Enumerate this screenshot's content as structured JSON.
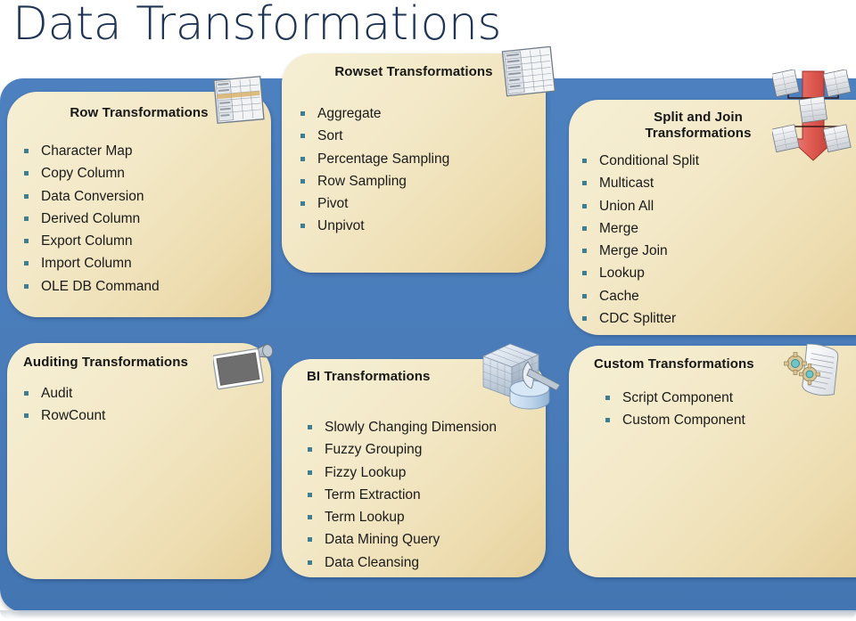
{
  "slide": {
    "title": "Data Transformations",
    "title_color": "#1F3556",
    "board_color": "#4A7CBA",
    "panel_color": "#F3E9C8",
    "bullet_color": "#3E7E92"
  },
  "panels": [
    {
      "id": "row",
      "title": "Row Transformations",
      "icon": "spreadsheet-grid-icon",
      "items": [
        "Character Map",
        "Copy Column",
        "Data Conversion",
        "Derived Column",
        "Export Column",
        "Import Column",
        "OLE DB Command"
      ]
    },
    {
      "id": "rowset",
      "title": "Rowset Transformations",
      "icon": "spreadsheet-grid-icon",
      "items": [
        "Aggregate",
        "Sort",
        "Percentage Sampling",
        "Row Sampling",
        "Pivot",
        "Unpivot"
      ]
    },
    {
      "id": "splitjoin",
      "title": "Split and Join Transformations",
      "title_line1": "Split and Join",
      "title_line2": "Transformations",
      "icon": "split-arrow-icon",
      "items": [
        "Conditional Split",
        "Multicast",
        "Union All",
        "Merge",
        "Merge Join",
        "Lookup",
        "Cache",
        "CDC Splitter"
      ]
    },
    {
      "id": "audit",
      "title": "Auditing Transformations",
      "icon": "monitor-icon",
      "items": [
        "Audit",
        "RowCount"
      ]
    },
    {
      "id": "bi",
      "title": "BI Transformations",
      "icon": "data-cube-icon",
      "items": [
        "Slowly Changing Dimension",
        "Fuzzy Grouping",
        "Fizzy Lookup",
        "Term Extraction",
        "Term Lookup",
        "Data Mining Query",
        "Data Cleansing"
      ]
    },
    {
      "id": "custom",
      "title": "Custom Transformations",
      "icon": "document-gears-icon",
      "items": [
        "Script Component",
        "Custom Component"
      ]
    }
  ]
}
